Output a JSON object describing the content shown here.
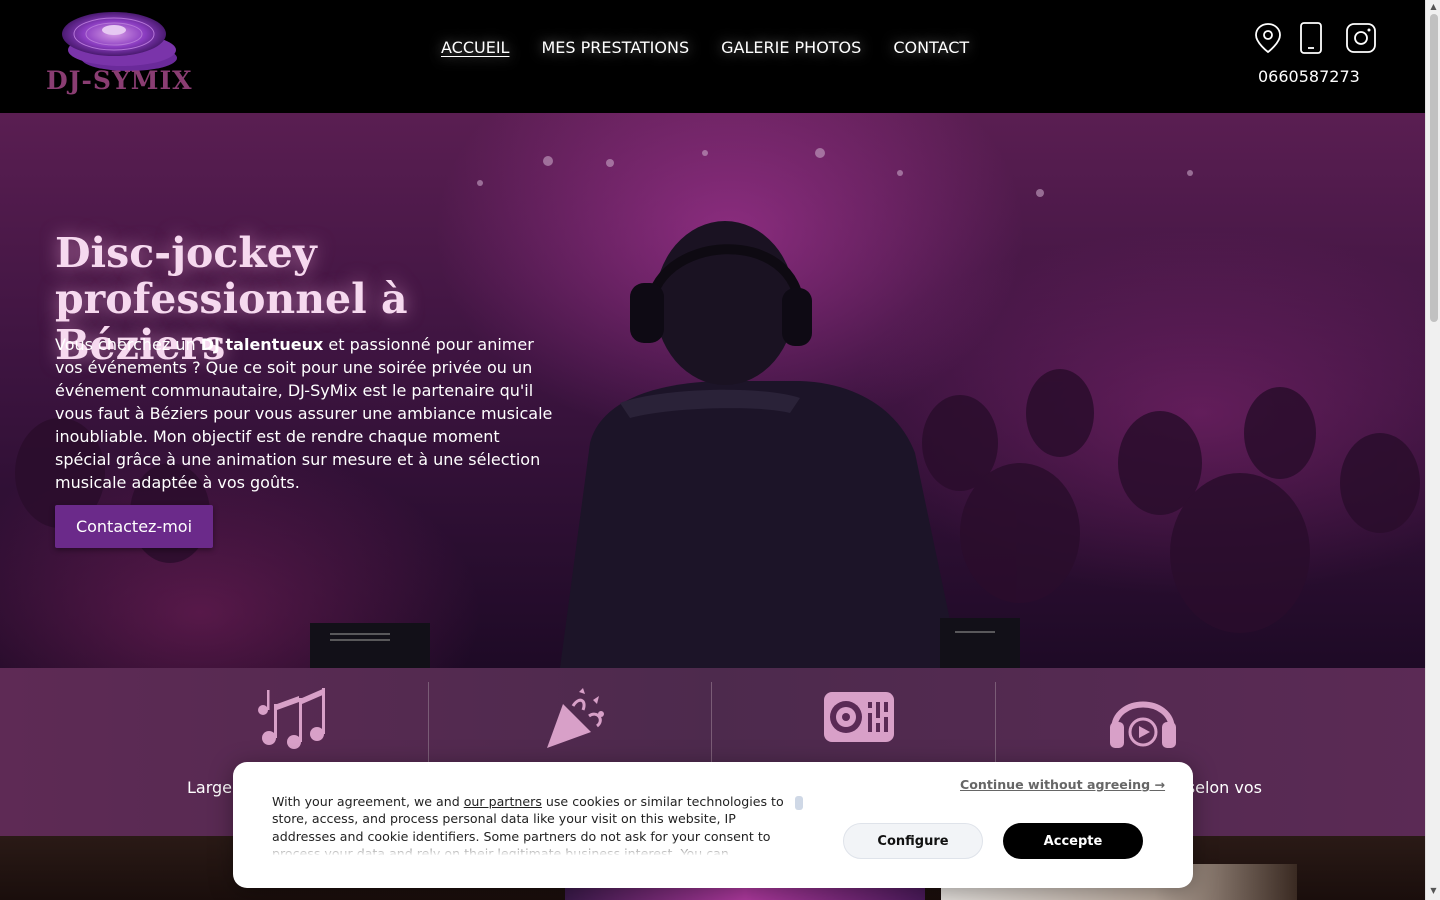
{
  "brand": {
    "logo_text": "DJ-SYMIX"
  },
  "nav": {
    "items": [
      {
        "label": "ACCUEIL",
        "active": true
      },
      {
        "label": "MES PRESTATIONS",
        "active": false
      },
      {
        "label": "GALERIE PHOTOS",
        "active": false
      },
      {
        "label": "CONTACT",
        "active": false
      }
    ]
  },
  "header_contact": {
    "icons": [
      "location-pin-icon",
      "smartphone-icon",
      "instagram-icon"
    ],
    "phone": "0660587273"
  },
  "hero": {
    "title": "Disc-jockey professionnel à Béziers",
    "text_before": "Vous cherchez un ",
    "text_bold": "DJ talentueux",
    "text_after": " et passionné pour animer vos événements ? Que ce soit pour une soirée privée ou un événement communautaire, DJ-SyMix est le partenaire qu'il vous faut à Béziers pour vous assurer une ambiance musicale inoubliable. Mon objectif est de rendre chaque moment spécial grâce à une animation sur mesure et à une sélection musicale adaptée à vos goûts.",
    "cta": "Contactez-moi"
  },
  "features": {
    "items": [
      {
        "icon": "music-notes-icon",
        "label": "Large"
      },
      {
        "icon": "party-popper-icon",
        "label": ""
      },
      {
        "icon": "turntable-icon",
        "label": ""
      },
      {
        "icon": "headphones-play-icon",
        "label": "selon vos"
      }
    ]
  },
  "cookie": {
    "text_before": "With your agreement, we and ",
    "partners_link": "our partners",
    "text_after": " use cookies or similar technologies to store, access, and process personal data like your visit on this website, IP addresses and cookie identifiers. Some partners do not ask for your consent to process your data and rely on their legitimate business interest. You can",
    "continue": "Continue without agreeing →",
    "configure": "Configure",
    "accept": "Accepte"
  },
  "colors": {
    "accent": "#6b2a8a",
    "icon_pink": "#d8a0c8",
    "title_pink": "#f6d9ef"
  }
}
